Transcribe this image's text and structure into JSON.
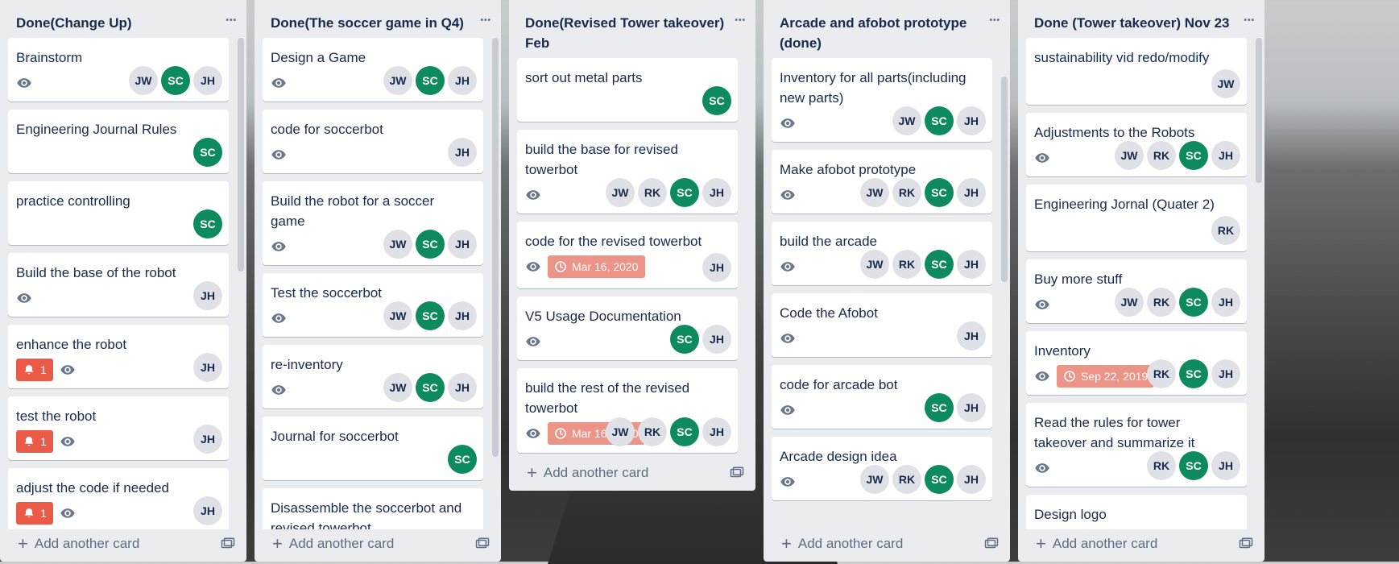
{
  "colors": {
    "accent_green": "#0e8a5f",
    "due_red": "#ec9488",
    "alert_red": "#eb5a46",
    "list_bg": "#ebecf0"
  },
  "add_card_label": "Add another card",
  "lists": [
    {
      "title": "Done(Change Up)",
      "cards": [
        {
          "title": "Brainstorm",
          "watch": true,
          "members": [
            "JW",
            "SC",
            "JH"
          ]
        },
        {
          "title": "Engineering Journal Rules",
          "watch": false,
          "members": [
            "SC"
          ]
        },
        {
          "title": "practice controlling",
          "watch": false,
          "members": [
            "SC"
          ]
        },
        {
          "title": "Build the base of the robot",
          "watch": true,
          "members": [
            "JH"
          ]
        },
        {
          "title": "enhance the robot",
          "watch": true,
          "alert": "1",
          "members": [
            "JH"
          ]
        },
        {
          "title": "test the robot",
          "watch": true,
          "alert": "1",
          "members": [
            "JH"
          ]
        },
        {
          "title": "adjust the code if needed",
          "watch": true,
          "alert": "1",
          "members": [
            "JH"
          ]
        }
      ]
    },
    {
      "title": "Done(The soccer game in Q4)",
      "cards": [
        {
          "title": "Design a Game",
          "watch": true,
          "members": [
            "JW",
            "SC",
            "JH"
          ]
        },
        {
          "title": "code for soccerbot",
          "watch": true,
          "members": [
            "JH"
          ]
        },
        {
          "title": "Build the robot for a soccer game",
          "watch": true,
          "members": [
            "JW",
            "SC",
            "JH"
          ]
        },
        {
          "title": "Test the soccerbot",
          "watch": true,
          "members": [
            "JW",
            "SC",
            "JH"
          ]
        },
        {
          "title": "re-inventory",
          "watch": true,
          "members": [
            "JW",
            "SC",
            "JH"
          ]
        },
        {
          "title": "Journal for soccerbot",
          "watch": false,
          "members": [
            "SC"
          ]
        },
        {
          "title": "Disassemble the soccerbot and revised towerbot",
          "watch": false,
          "members": []
        }
      ]
    },
    {
      "title": "Done(Revised Tower takeover) Feb",
      "cards": [
        {
          "title": "sort out metal parts",
          "watch": false,
          "members": [
            "SC"
          ]
        },
        {
          "title": "build the base for revised towerbot",
          "watch": true,
          "members": [
            "JW",
            "RK",
            "SC",
            "JH"
          ]
        },
        {
          "title": "code for the revised towerbot",
          "watch": true,
          "due": "Mar 16, 2020",
          "members": [
            "JH"
          ]
        },
        {
          "title": "V5 Usage Documentation",
          "watch": true,
          "members": [
            "SC",
            "JH"
          ]
        },
        {
          "title": "build the rest of the revised towerbot",
          "watch": true,
          "due": "Mar 16, 2020",
          "members": [
            "JW",
            "RK",
            "SC",
            "JH"
          ]
        }
      ]
    },
    {
      "title": "Arcade and afobot prototype (done)",
      "cards": [
        {
          "title": "Inventory for all parts(including new parts)",
          "watch": true,
          "members": [
            "JW",
            "SC",
            "JH"
          ]
        },
        {
          "title": "Make afobot prototype",
          "watch": true,
          "members": [
            "JW",
            "RK",
            "SC",
            "JH"
          ]
        },
        {
          "title": "build the arcade",
          "watch": true,
          "members": [
            "JW",
            "RK",
            "SC",
            "JH"
          ]
        },
        {
          "title": "Code the Afobot",
          "watch": true,
          "members": [
            "JH"
          ]
        },
        {
          "title": "code for arcade bot",
          "watch": true,
          "members": [
            "SC",
            "JH"
          ]
        },
        {
          "title": "Arcade design idea",
          "watch": true,
          "members": [
            "JW",
            "RK",
            "SC",
            "JH"
          ]
        }
      ]
    },
    {
      "title": "Done (Tower takeover) Nov 23",
      "cards": [
        {
          "title": "sustainability vid redo/modify",
          "watch": false,
          "members": [
            "JW"
          ]
        },
        {
          "title": "Adjustments to the Robots",
          "watch": true,
          "members": [
            "JW",
            "RK",
            "SC",
            "JH"
          ]
        },
        {
          "title": "Engineering Jornal (Quater 2)",
          "watch": false,
          "members": [
            "RK"
          ]
        },
        {
          "title": "Buy more stuff",
          "watch": true,
          "members": [
            "JW",
            "RK",
            "SC",
            "JH"
          ]
        },
        {
          "title": "Inventory",
          "watch": true,
          "due": "Sep 22, 2019",
          "members": [
            "RK",
            "SC",
            "JH"
          ]
        },
        {
          "title": "Read the rules for tower takeover and summarize it",
          "watch": true,
          "members": [
            "RK",
            "SC",
            "JH"
          ]
        },
        {
          "title": "Design logo",
          "watch": false,
          "members": []
        }
      ]
    }
  ]
}
